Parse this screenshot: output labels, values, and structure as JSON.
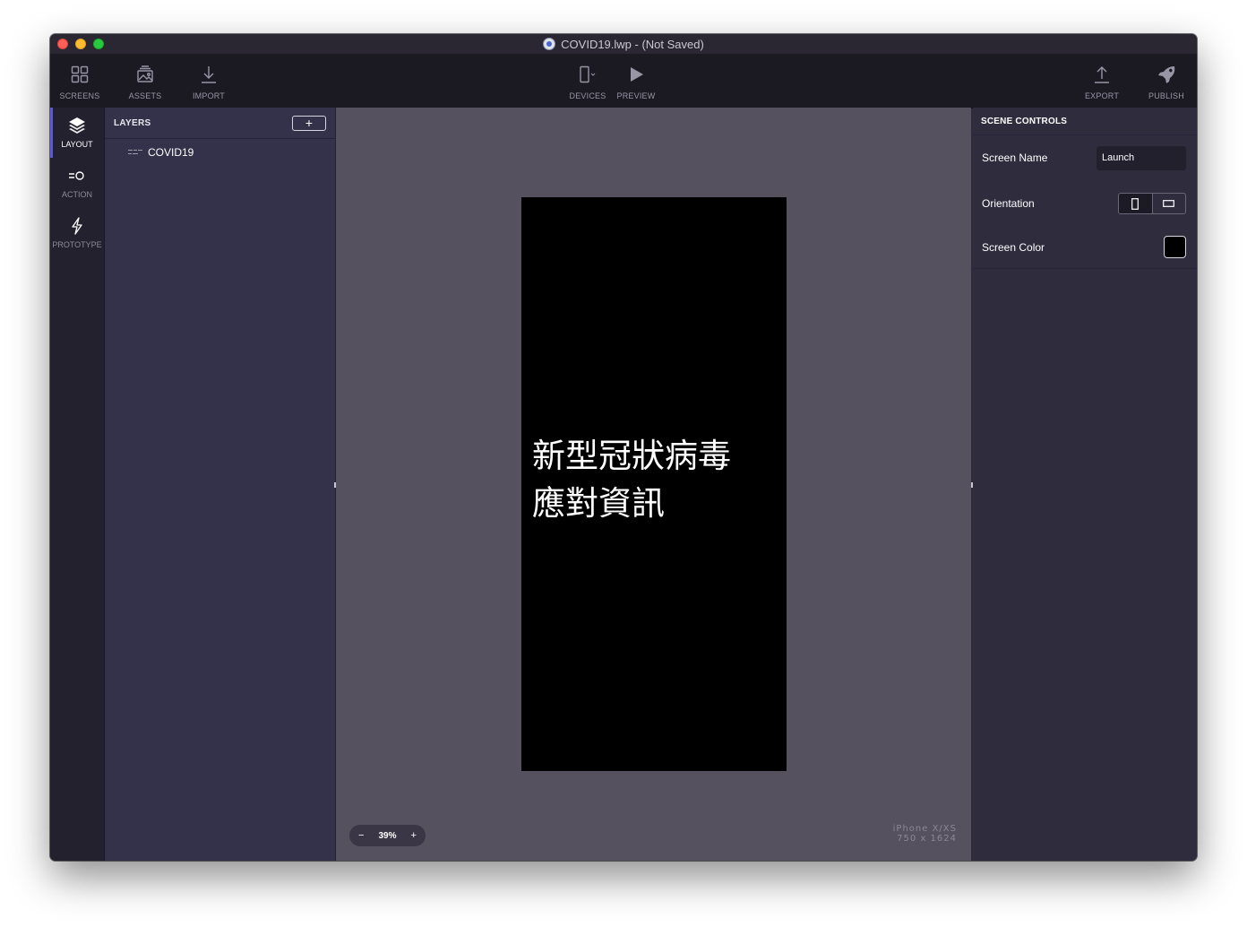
{
  "window": {
    "title": "COVID19.lwp - (Not Saved)"
  },
  "toolbar": {
    "screens_label": "SCREENS",
    "assets_label": "ASSETS",
    "import_label": "IMPORT",
    "devices_label": "DEVICES",
    "preview_label": "PREVIEW",
    "export_label": "EXPORT",
    "publish_label": "PUBLISH"
  },
  "rail": {
    "items": [
      {
        "label": "LAYOUT",
        "icon": "layers-icon",
        "active": true
      },
      {
        "label": "ACTION",
        "icon": "action-icon",
        "active": false
      },
      {
        "label": "PROTOTYPE",
        "icon": "lightning-icon",
        "active": false
      }
    ]
  },
  "layers": {
    "title": "LAYERS",
    "add_label": "+",
    "items": [
      {
        "name": "COVID19"
      }
    ]
  },
  "canvas": {
    "screen_text": "新型冠狀病毒\n應對資訊",
    "screen_background": "#000000",
    "zoom_minus": "−",
    "zoom_value": "39%",
    "zoom_plus": "+",
    "device_name": "iPhone X/XS",
    "device_size": "750 x 1624"
  },
  "scene_controls": {
    "title": "SCENE CONTROLS",
    "screen_name_label": "Screen Name",
    "screen_name_value": "Launch",
    "orientation_label": "Orientation",
    "screen_color_label": "Screen Color",
    "screen_color_value": "#000000"
  },
  "colors": {
    "accent": "#5b57d9",
    "toolbar_bg": "#1b1a22",
    "panel_bg": "#34314a",
    "canvas_bg": "#55515f"
  }
}
